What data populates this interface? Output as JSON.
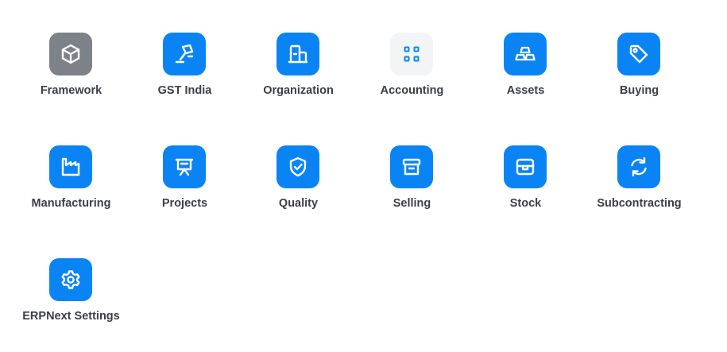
{
  "apps": [
    {
      "label": "Framework",
      "icon": "cube-icon",
      "color": "#7d8188"
    },
    {
      "label": "GST India",
      "icon": "gavel-icon",
      "color": "#0a84f5"
    },
    {
      "label": "Organization",
      "icon": "building-icon",
      "color": "#0a84f5"
    },
    {
      "label": "Accounting",
      "icon": "grid-apps-icon",
      "color": "#f3f4f6"
    },
    {
      "label": "Assets",
      "icon": "gold-bars-icon",
      "color": "#0a84f5"
    },
    {
      "label": "Buying",
      "icon": "tag-icon",
      "color": "#0a84f5"
    },
    {
      "label": "Manufacturing",
      "icon": "factory-icon",
      "color": "#0a84f5"
    },
    {
      "label": "Projects",
      "icon": "presentation-board-icon",
      "color": "#0a84f5"
    },
    {
      "label": "Quality",
      "icon": "shield-check-icon",
      "color": "#0a84f5"
    },
    {
      "label": "Selling",
      "icon": "storefront-icon",
      "color": "#0a84f5"
    },
    {
      "label": "Stock",
      "icon": "box-icon",
      "color": "#0a84f5"
    },
    {
      "label": "Subcontracting",
      "icon": "refresh-icon",
      "color": "#0a84f5"
    },
    {
      "label": "ERPNext Settings",
      "icon": "settings-gear-icon",
      "color": "#0a84f5"
    }
  ]
}
